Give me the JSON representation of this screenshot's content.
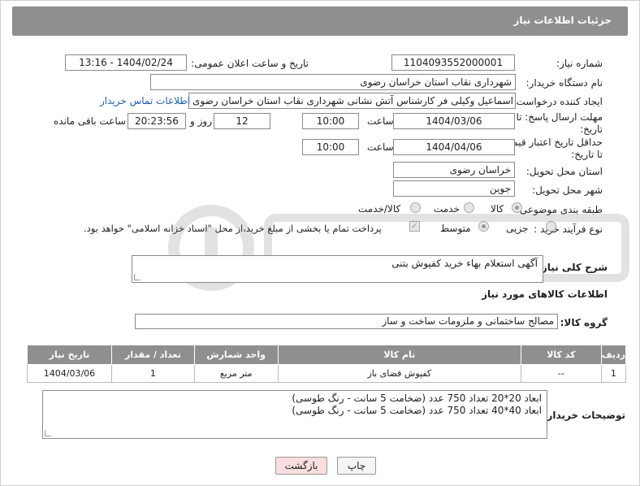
{
  "header": {
    "title": "جزئیات اطلاعات نیاز"
  },
  "fields": {
    "need_number_label": "شماره نیاز:",
    "need_number": "1104093552000001",
    "announce_label": "تاریخ و ساعت اعلان عمومی:",
    "announce_value": "1404/02/24 - 13:16",
    "buyer_org_label": "نام دستگاه خریدار:",
    "buyer_org": "شهرداری نقاب استان خراسان رضوی",
    "requester_label": "ایجاد کننده درخواست:",
    "requester": "اسماعیل وکیلی فر کارشناس آتش نشانی شهرداری نقاب استان خراسان رضوی",
    "contact_link": "اطلاعات تماس خریدار",
    "deadline_label_1": "مهلت ارسال پاسخ: تا",
    "deadline_label_2": "تاریخ:",
    "deadline_date": "1404/03/06",
    "time_label": "ساعت",
    "deadline_time": "10:00",
    "days_value": "12",
    "days_label": "روز و",
    "remaining_time": "20:23:56",
    "remaining_label": "ساعت باقی مانده",
    "min_validity_label_1": "حداقل تاریخ اعتبار قیمت:",
    "min_validity_label_2": "تا تاریخ:",
    "validity_date": "1404/04/06",
    "validity_time": "10:00",
    "delivery_province_label": "استان محل تحویل:",
    "delivery_province": "خراسان رضوی",
    "delivery_city_label": "شهر محل تحویل:",
    "delivery_city": "جوین",
    "category_label": "طبقه بندی موضوعی:",
    "category_options": [
      "کالا",
      "خدمت",
      "کالا/خدمت"
    ],
    "process_label": "نوع فرآیند خرید :",
    "process_options": [
      "جزیی",
      "متوسط"
    ],
    "payment_note": "پرداخت تمام یا بخشی از مبلغ خرید،از محل \"اسناد خزانه اسلامی\" خواهد بود.",
    "description_label": "شرح کلی نیاز:",
    "description": "آگهی استعلام بهاء خرید کفپوش بتنی"
  },
  "goods": {
    "section_title": "اطلاعات کالاهای مورد نیاز",
    "group_label": "گروه کالا:",
    "group_value": "مصالح ساختمانی و ملزومات ساخت و ساز",
    "columns": [
      "ردیف",
      "کد کالا",
      "نام کالا",
      "واحد شمارش",
      "تعداد / مقدار",
      "تاریخ نیاز"
    ],
    "rows": [
      [
        "1",
        "--",
        "کفپوش فضای باز",
        "متر مربع",
        "1",
        "1404/03/06"
      ]
    ]
  },
  "buyer_notes": {
    "label": "توضیحات خریدار:",
    "line1": "ابعاد 20*20 تعداد 750 عدد (ضخامت 5 سانت - رنگ طوسی)",
    "line2": "ابعاد 40*40 تعداد 750 عدد (ضخامت 5 سانت - رنگ طوسی)"
  },
  "buttons": {
    "print": "چاپ",
    "back": "بازگشت"
  },
  "colors": {
    "header_bg": "#8f8f8f",
    "link": "#1a5fb4",
    "back_btn": "#f8dede"
  }
}
